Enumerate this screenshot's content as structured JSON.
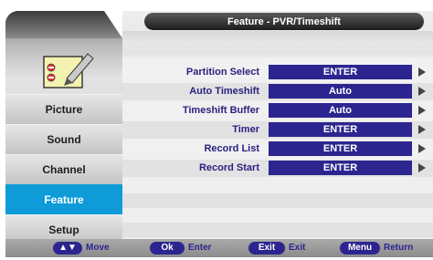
{
  "window": {
    "title": "Feature - PVR/Timeshift"
  },
  "icons": {
    "feature_icon": "notepad-pencil-icon",
    "row_arrow": "triangle-right-icon",
    "nav_arrows": "up-down-arrows-icon"
  },
  "sidebar": {
    "items": [
      {
        "label": "Picture",
        "active": false
      },
      {
        "label": "Sound",
        "active": false
      },
      {
        "label": "Channel",
        "active": false
      },
      {
        "label": "Feature",
        "active": true
      },
      {
        "label": "Setup",
        "active": false
      }
    ]
  },
  "settings": [
    {
      "label": "Partition Select",
      "value": "ENTER"
    },
    {
      "label": "Auto Timeshift",
      "value": "Auto"
    },
    {
      "label": "Timeshift Buffer",
      "value": "Auto"
    },
    {
      "label": "Timer",
      "value": "ENTER"
    },
    {
      "label": "Record List",
      "value": "ENTER"
    },
    {
      "label": "Record Start",
      "value": "ENTER"
    }
  ],
  "help_bar": {
    "nav_key": "▲▼",
    "nav_text": "Move",
    "ok_key": "Ok",
    "ok_text": "Enter",
    "exit_key": "Exit",
    "exit_text": "Exit",
    "menu_key": "Menu",
    "menu_text": "Return"
  },
  "colors": {
    "accent_blue": "#0e9bd8",
    "value_box": "#2c2590",
    "label_text": "#2b2280"
  }
}
